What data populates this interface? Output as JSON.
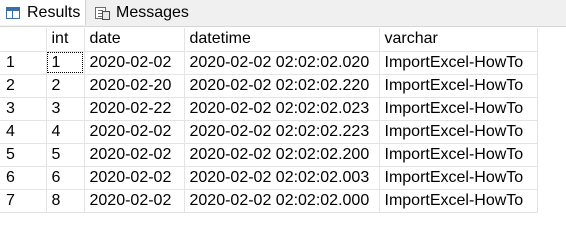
{
  "tabs": [
    {
      "label": "Results",
      "icon": "grid-icon",
      "active": true
    },
    {
      "label": "Messages",
      "icon": "messages-icon",
      "active": false
    }
  ],
  "grid": {
    "columns": [
      "",
      "int",
      "date",
      "datetime",
      "varchar"
    ],
    "rows": [
      [
        "1",
        "1",
        "2020-02-02",
        "2020-02-02 02:02:02.020",
        "ImportExcel-HowTo"
      ],
      [
        "2",
        "2",
        "2020-02-20",
        "2020-02-02 02:02:02.220",
        "ImportExcel-HowTo"
      ],
      [
        "3",
        "3",
        "2020-02-22",
        "2020-02-02 02:02:02.023",
        "ImportExcel-HowTo"
      ],
      [
        "4",
        "4",
        "2020-02-02",
        "2020-02-02 02:02:02.223",
        "ImportExcel-HowTo"
      ],
      [
        "5",
        "5",
        "2020-02-02",
        "2020-02-02 02:02:02.200",
        "ImportExcel-HowTo"
      ],
      [
        "6",
        "6",
        "2020-02-02",
        "2020-02-02 02:02:02.003",
        "ImportExcel-HowTo"
      ],
      [
        "7",
        "8",
        "2020-02-02",
        "2020-02-02 02:02:02.000",
        "ImportExcel-HowTo"
      ]
    ]
  }
}
